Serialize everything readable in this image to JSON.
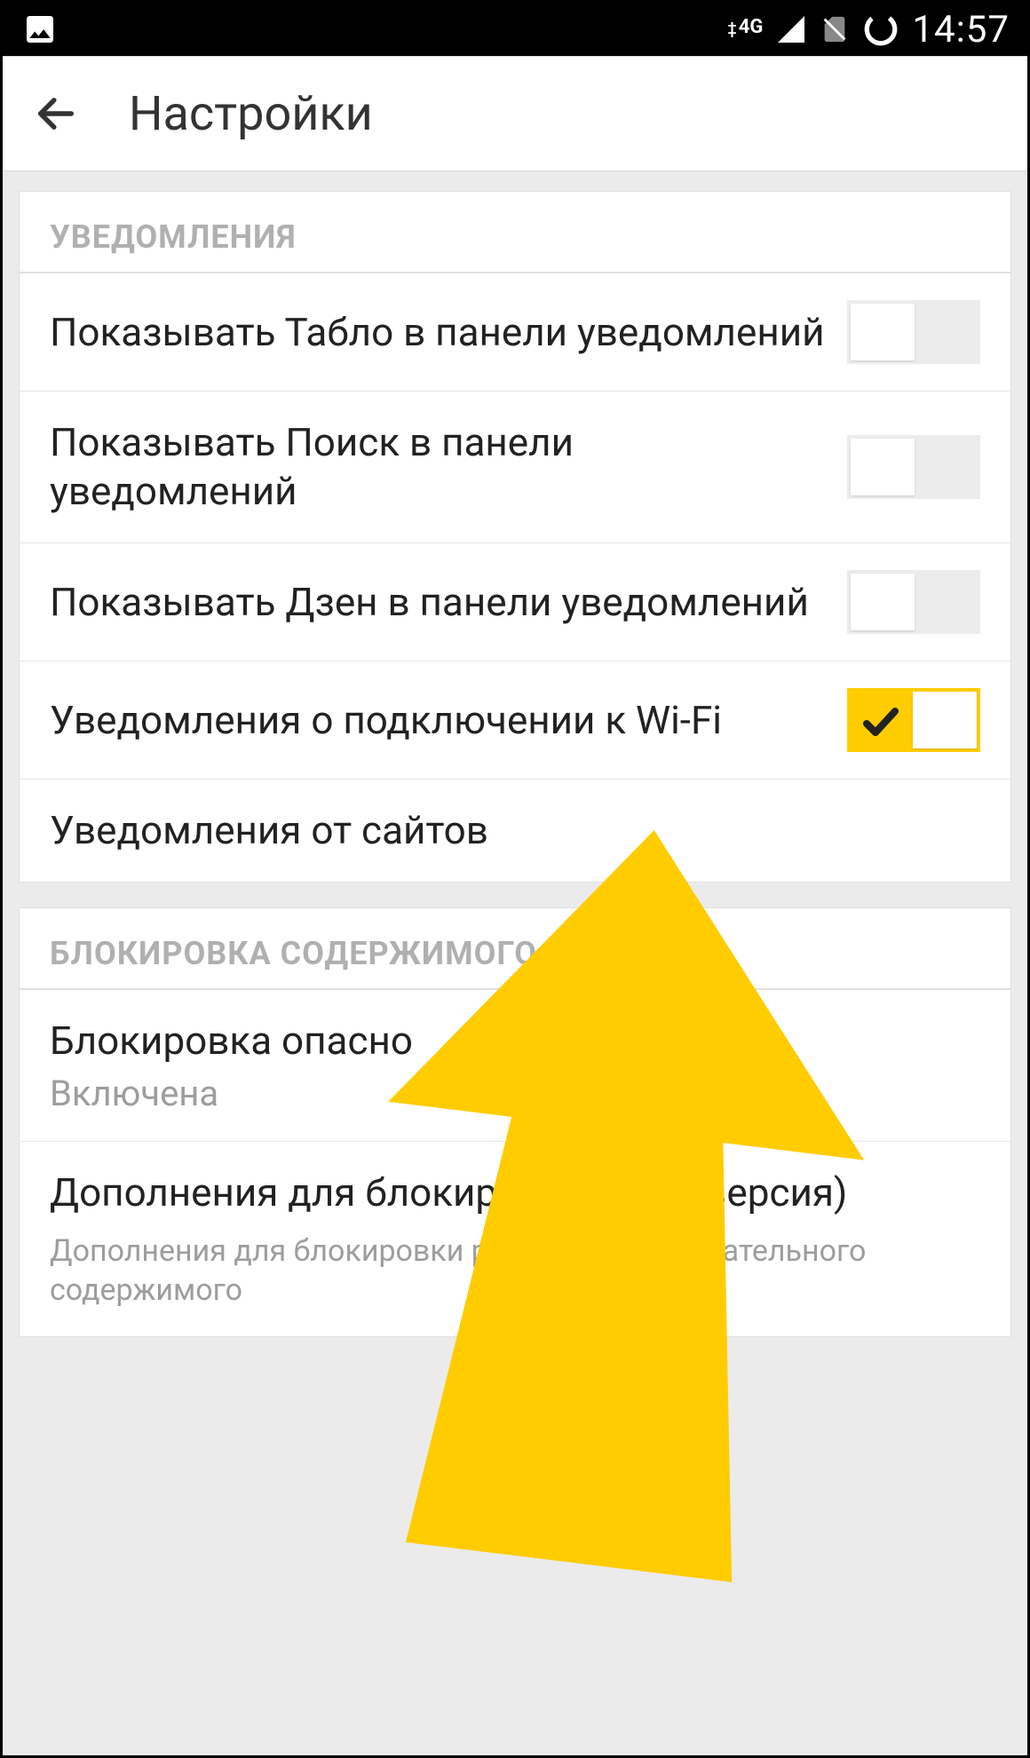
{
  "statusbar": {
    "network": "4G",
    "time": "14:57"
  },
  "header": {
    "title": "Настройки"
  },
  "sections": {
    "notifications": {
      "title": "УВЕДОМЛЕНИЯ",
      "items": {
        "tablo": {
          "label": "Показывать Табло в панели уведомлений",
          "on": false
        },
        "search": {
          "label": "Показывать Поиск в панели уведомлений",
          "on": false
        },
        "zen": {
          "label": "Показывать Дзен в панели уведомлений",
          "on": false
        },
        "wifi": {
          "label": "Уведомления о подключении к Wi-Fi",
          "on": true
        },
        "sites": {
          "label": "Уведомления от сайтов"
        }
      }
    },
    "blocking": {
      "title": "БЛОКИРОВКА СОДЕРЖИМОГО",
      "items": {
        "danger": {
          "label": "Блокировка опасно",
          "sub": "Включена"
        },
        "addons": {
          "label": "Дополнения для блокировки (Бета-версия)",
          "desc": "Дополнения для блокировки рекламы и нежелательного содержимого"
        }
      }
    }
  }
}
